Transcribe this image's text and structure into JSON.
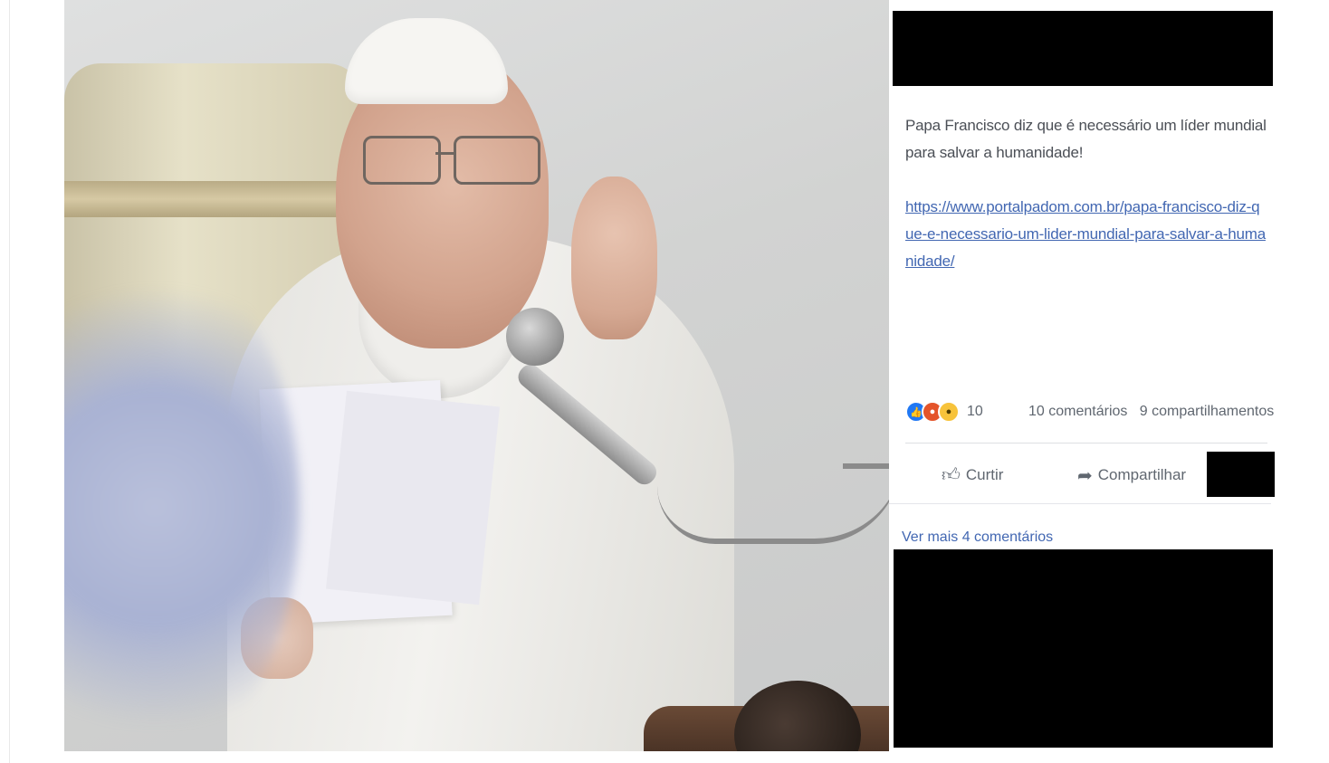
{
  "post": {
    "text": "Papa Francisco diz que é necessário um líder mundial para salvar a humanidade!",
    "link": "https://www.portalpadom.com.br/papa-francisco-diz-que-e-necessario-um-lider-mundial-para-salvar-a-humanidade/"
  },
  "reactions": {
    "count": "10",
    "icons": [
      "like-icon",
      "angry-icon",
      "wow-icon"
    ],
    "comments_label": "10 comentários",
    "shares_label": "9 compartilhamentos"
  },
  "actions": {
    "like_label": "Curtir",
    "share_label": "Compartilhar"
  },
  "comments": {
    "more_label": "Ver mais 4 comentários"
  },
  "colors": {
    "link": "#4267b2",
    "redaction": "#000000",
    "like_reaction": "#2078f4",
    "angry_reaction": "#e4542a",
    "wow_reaction": "#f7c33b"
  }
}
